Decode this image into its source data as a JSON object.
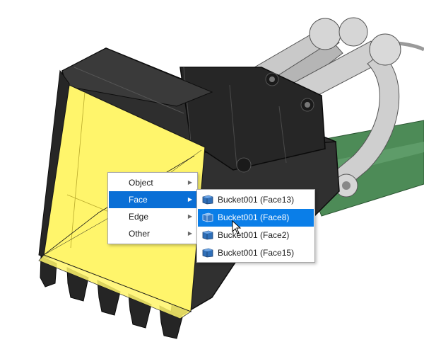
{
  "context_menu": {
    "items": [
      {
        "label": "Object",
        "has_submenu": true,
        "selected": false
      },
      {
        "label": "Face",
        "has_submenu": true,
        "selected": true
      },
      {
        "label": "Edge",
        "has_submenu": true,
        "selected": false
      },
      {
        "label": "Other",
        "has_submenu": true,
        "selected": false
      }
    ]
  },
  "face_submenu": {
    "items": [
      {
        "label": "Bucket001 (Face13)",
        "icon": "face-icon",
        "hovered": false
      },
      {
        "label": "Bucket001 (Face8)",
        "icon": "face-icon",
        "hovered": true
      },
      {
        "label": "Bucket001 (Face2)",
        "icon": "face-icon",
        "hovered": false
      },
      {
        "label": "Bucket001 (Face15)",
        "icon": "face-icon",
        "hovered": false
      }
    ]
  },
  "colors": {
    "selection_blue": "#0a6fd6",
    "bucket_body": "#2a2a2a",
    "highlighted_face": "#fff56b",
    "arm_green": "#4d8b57",
    "linkage_gray": "#c4c4c4"
  },
  "arrow_glyph": "▶"
}
